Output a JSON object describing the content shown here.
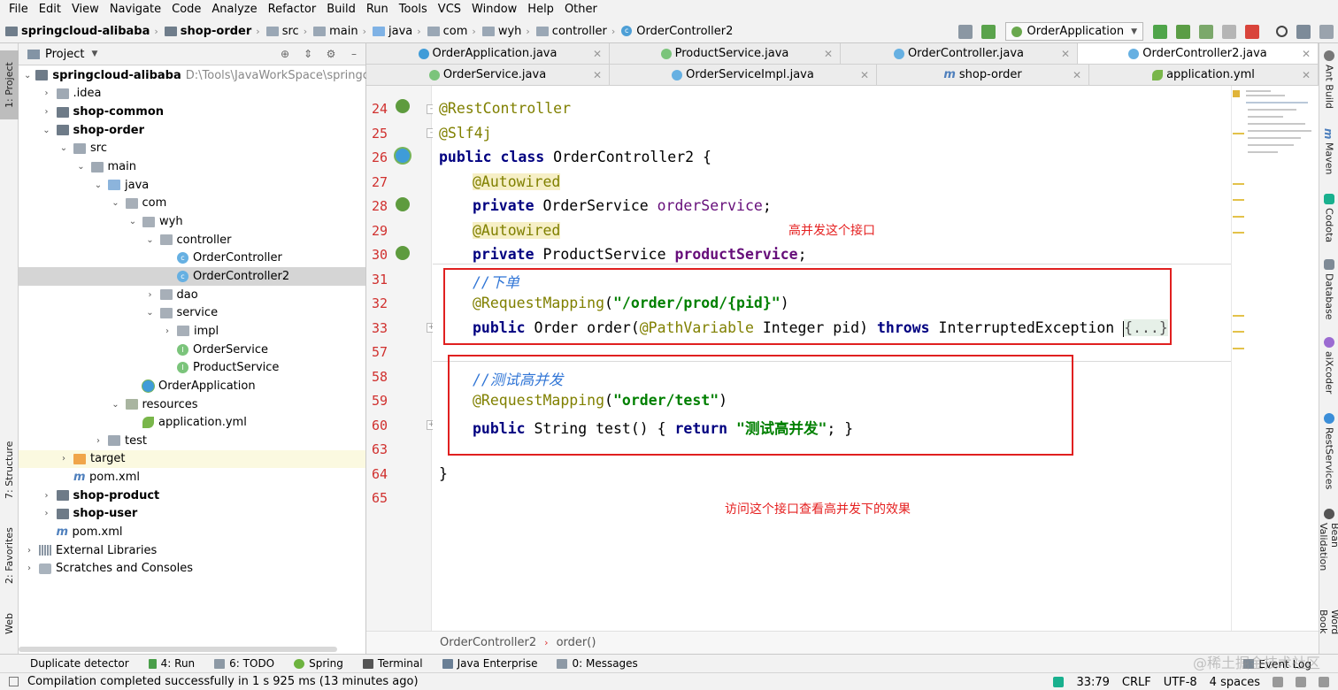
{
  "menu": [
    "File",
    "Edit",
    "View",
    "Navigate",
    "Code",
    "Analyze",
    "Refactor",
    "Build",
    "Run",
    "Tools",
    "VCS",
    "Window",
    "Help",
    "Other"
  ],
  "nav_breadcrumb": [
    "springcloud-alibaba",
    "shop-order",
    "src",
    "main",
    "java",
    "com",
    "wyh",
    "controller",
    "OrderController2"
  ],
  "run_config": "OrderApplication",
  "left_strip": {
    "project": "1: Project",
    "structure": "7: Structure",
    "favorites": "2: Favorites",
    "web": "Web"
  },
  "right_strip": [
    "Ant Build",
    "Maven",
    "Codota",
    "Database",
    "aiXcoder",
    "RestServices",
    "Bean Validation",
    "Word Book"
  ],
  "project_panel": {
    "title": "Project",
    "root_path": "D:\\Tools\\JavaWorkSpace\\springcloud-a",
    "tree": [
      {
        "label": "springcloud-alibaba",
        "icon": "module-folder-icon",
        "bold": true,
        "state": "open"
      },
      {
        "label": ".idea",
        "icon": "folder-icon",
        "state": "closed"
      },
      {
        "label": "shop-common",
        "icon": "module-folder-icon",
        "bold": true,
        "state": "closed"
      },
      {
        "label": "shop-order",
        "icon": "module-folder-icon",
        "bold": true,
        "state": "open"
      },
      {
        "label": "src",
        "icon": "folder-icon",
        "state": "open"
      },
      {
        "label": "main",
        "icon": "folder-icon",
        "state": "open"
      },
      {
        "label": "java",
        "icon": "source-folder-icon",
        "state": "open"
      },
      {
        "label": "com",
        "icon": "package-icon",
        "state": "open"
      },
      {
        "label": "wyh",
        "icon": "package-icon",
        "state": "open"
      },
      {
        "label": "controller",
        "icon": "package-icon",
        "state": "open"
      },
      {
        "label": "OrderController",
        "icon": "class-icon",
        "state": "leaf"
      },
      {
        "label": "OrderController2",
        "icon": "class-icon",
        "state": "leaf",
        "selected": true
      },
      {
        "label": "dao",
        "icon": "package-icon",
        "state": "closed"
      },
      {
        "label": "service",
        "icon": "package-icon",
        "state": "open"
      },
      {
        "label": "impl",
        "icon": "package-icon",
        "state": "closed"
      },
      {
        "label": "OrderService",
        "icon": "interface-icon",
        "state": "leaf"
      },
      {
        "label": "ProductService",
        "icon": "interface-icon",
        "state": "leaf"
      },
      {
        "label": "OrderApplication",
        "icon": "spring-app-icon",
        "state": "leaf"
      },
      {
        "label": "resources",
        "icon": "resources-folder-icon",
        "state": "open"
      },
      {
        "label": "application.yml",
        "icon": "yaml-icon",
        "state": "leaf"
      },
      {
        "label": "test",
        "icon": "folder-icon",
        "state": "closed"
      },
      {
        "label": "target",
        "icon": "excluded-folder-icon",
        "state": "closed",
        "highlight": true
      },
      {
        "label": "pom.xml",
        "icon": "maven-icon",
        "state": "leaf"
      },
      {
        "label": "shop-product",
        "icon": "module-folder-icon",
        "bold": true,
        "state": "closed"
      },
      {
        "label": "shop-user",
        "icon": "module-folder-icon",
        "bold": true,
        "state": "closed"
      },
      {
        "label": "pom.xml",
        "icon": "maven-icon",
        "state": "leaf"
      },
      {
        "label": "External Libraries",
        "icon": "library-icon",
        "state": "closed"
      },
      {
        "label": "Scratches and Consoles",
        "icon": "scratch-icon",
        "state": "closed"
      }
    ]
  },
  "editor_tabs_row1": [
    "OrderApplication.java",
    "ProductService.java",
    "OrderController.java",
    "OrderController2.java"
  ],
  "editor_tabs_row2": [
    "OrderService.java",
    "OrderServiceImpl.java",
    "shop-order",
    "application.yml"
  ],
  "active_tab": "OrderController2.java",
  "code": {
    "line_numbers": [
      "24",
      "25",
      "26",
      "27",
      "28",
      "29",
      "30",
      "31",
      "32",
      "33",
      "57",
      "58",
      "59",
      "60",
      "63",
      "64",
      "65"
    ],
    "l24": "@RestController",
    "l25": "@Slf4j",
    "l26_kw": "public class",
    "l26_rest": " OrderController2 {",
    "l27": "@Autowired",
    "l28_kw": "private",
    "l28_type": " OrderService ",
    "l28_field": "orderService",
    "l28_end": ";",
    "l29": "@Autowired",
    "l30_kw": "private",
    "l30_type": " ProductService ",
    "l30_field": "productService",
    "l30_end": ";",
    "l31": "//下单",
    "l32_anno": "@RequestMapping",
    "l32_open": "(",
    "l32_str": "\"/order/prod/{pid}\"",
    "l32_close": ")",
    "l33_kw": "public",
    "l33_a": " Order order(",
    "l33_anno": "@PathVariable",
    "l33_b": " Integer pid) ",
    "l33_throws": "throws",
    "l33_c": " InterruptedException ",
    "l33_fold": "{...}",
    "l58": "//测试高并发",
    "l59_anno": "@RequestMapping",
    "l59_open": "(",
    "l59_str": "\"order/test\"",
    "l59_close": ")",
    "l60_kw": "public",
    "l60_a": " String test() { ",
    "l60_return": "return",
    "l60_sp": " ",
    "l60_str": "\"测试高并发\"",
    "l60_end": "; }",
    "l64": "}"
  },
  "annotations": {
    "note1": "高并发这个接口",
    "note2": "访问这个接口查看高并发下的效果"
  },
  "editor_breadcrumb": [
    "OrderController2",
    "order()"
  ],
  "bottom_tools": [
    "Duplicate detector",
    "4: Run",
    "6: TODO",
    "Spring",
    "Terminal",
    "Java Enterprise",
    "0: Messages"
  ],
  "event_log": "Event Log",
  "watermark": "@稀土掘金技术社区",
  "status": {
    "message": "Compilation completed successfully in 1 s 925 ms (13 minutes ago)",
    "position": "33:79",
    "line_sep": "CRLF",
    "encoding": "UTF-8",
    "indent": "4 spaces"
  },
  "colors": {
    "annotation_red": "#e02020",
    "keyword": "#000080",
    "string": "#008000",
    "field": "#660e7a",
    "comment": "#3176d6"
  }
}
